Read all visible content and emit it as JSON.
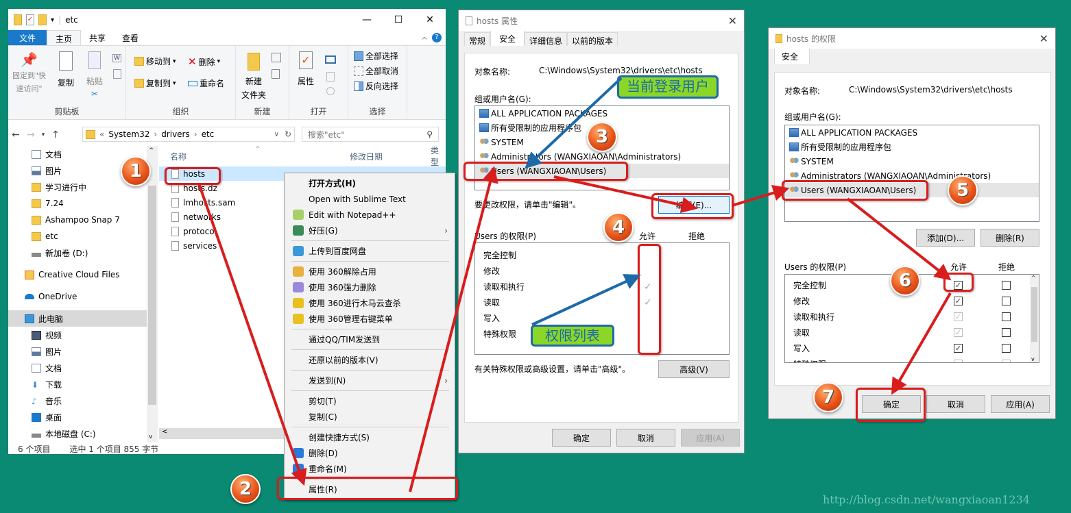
{
  "explorer": {
    "title": "etc",
    "window_buttons": [
      "—",
      "☐",
      "✕"
    ],
    "ribbon_tabs": [
      "文件",
      "主页",
      "共享",
      "查看"
    ],
    "ribbon": {
      "clipboard": {
        "label": "剪贴板",
        "pin": "固定到\"快速访问\"",
        "pin_line1": "固定到\"快",
        "pin_line2": "速访问\"",
        "copy": "复制",
        "paste": "粘贴"
      },
      "organize": {
        "label": "组织",
        "move_to": "移动到",
        "copy_to": "复制到",
        "delete": "删除",
        "rename": "重命名"
      },
      "new": {
        "label": "新建",
        "new_folder_line1": "新建",
        "new_folder_line2": "文件夹"
      },
      "open": {
        "label": "打开",
        "properties": "属性"
      },
      "select": {
        "label": "选择",
        "select_all": "全部选择",
        "select_none": "全部取消",
        "invert": "反向选择"
      }
    },
    "address": {
      "crumbs": [
        "«",
        "System32",
        "›",
        "drivers",
        "›",
        "etc"
      ]
    },
    "search": {
      "placeholder": "搜索\"etc\""
    },
    "nav": [
      {
        "label": "文档",
        "icon": "document-icon"
      },
      {
        "label": "图片",
        "icon": "pictures-icon"
      },
      {
        "label": "学习进行中",
        "icon": "folder-icon"
      },
      {
        "label": "7.24",
        "icon": "folder-icon"
      },
      {
        "label": "Ashampoo Snap 7",
        "icon": "folder-icon"
      },
      {
        "label": "etc",
        "icon": "folder-icon"
      },
      {
        "label": "新加卷 (D:)",
        "icon": "drive-icon"
      },
      {
        "label": "Creative Cloud Files",
        "icon": "creative-cloud-icon"
      },
      {
        "label": "OneDrive",
        "icon": "onedrive-icon"
      },
      {
        "label": "此电脑",
        "icon": "computer-icon"
      },
      {
        "label": "视频",
        "icon": "video-icon"
      },
      {
        "label": "图片",
        "icon": "pictures-icon"
      },
      {
        "label": "文档",
        "icon": "document-icon"
      },
      {
        "label": "下载",
        "icon": "download-icon"
      },
      {
        "label": "音乐",
        "icon": "music-icon"
      },
      {
        "label": "桌面",
        "icon": "desktop-icon"
      },
      {
        "label": "本地磁盘 (C:)",
        "icon": "drive-icon"
      }
    ],
    "columns": [
      "名称",
      "修改日期",
      "类型"
    ],
    "files": [
      "hosts",
      "hosts.dz",
      "lmhosts.sam",
      "networks",
      "protocol",
      "services"
    ],
    "status": {
      "count": "6 个项目",
      "selected": "选中 1 个项目  855 字节"
    }
  },
  "context_menu": {
    "items": [
      {
        "label": "打开方式(H)",
        "bold": true
      },
      {
        "label": "Open with Sublime Text"
      },
      {
        "label": "Edit with Notepad++",
        "icon": "notepad-plus-icon"
      },
      {
        "label": "好压(G)",
        "icon": "haozip-icon",
        "submenu": true
      },
      {
        "sep": true
      },
      {
        "label": "上传到百度网盘",
        "icon": "baidu-cloud-icon"
      },
      {
        "sep": true
      },
      {
        "label": "使用 360解除占用",
        "icon": "360-unlock-icon"
      },
      {
        "label": "使用 360强力删除",
        "icon": "360-delete-icon"
      },
      {
        "label": "使用 360进行木马云查杀",
        "icon": "360-scan-icon"
      },
      {
        "label": "使用 360管理右键菜单",
        "icon": "360-manage-icon"
      },
      {
        "sep": true
      },
      {
        "label": "通过QQ/TIM发送到"
      },
      {
        "sep": true
      },
      {
        "label": "还原以前的版本(V)"
      },
      {
        "sep": true
      },
      {
        "label": "发送到(N)",
        "submenu": true
      },
      {
        "sep": true
      },
      {
        "label": "剪切(T)"
      },
      {
        "label": "复制(C)"
      },
      {
        "sep": true
      },
      {
        "label": "创建快捷方式(S)"
      },
      {
        "label": "删除(D)",
        "icon": "shield-icon"
      },
      {
        "label": "重命名(M)",
        "icon": "shield-icon"
      },
      {
        "sep": true
      },
      {
        "label": "属性(R)"
      }
    ]
  },
  "properties": {
    "title": "hosts 属性",
    "tabs": [
      "常规",
      "安全",
      "详细信息",
      "以前的版本"
    ],
    "active_tab": "安全",
    "object_label": "对象名称:",
    "object_path": "C:\\Windows\\System32\\drivers\\etc\\hosts",
    "group_label": "组或用户名(G):",
    "users": [
      {
        "name": "ALL APPLICATION PACKAGES",
        "icon": "package-icon"
      },
      {
        "name": "所有受限制的应用程序包",
        "icon": "package-icon"
      },
      {
        "name": "SYSTEM",
        "icon": "group-icon"
      },
      {
        "name": "Administrators (WANGXIAOAN\\Administrators)",
        "icon": "group-icon"
      },
      {
        "name": "Users (WANGXIAOAN\\Users)",
        "icon": "group-icon",
        "selected": true
      }
    ],
    "edit_hint": "要更改权限，请单击\"编辑\"。",
    "edit_button": "编辑(E)...",
    "perm_label": "Users 的权限(P)",
    "allow": "允许",
    "deny": "拒绝",
    "permissions": [
      {
        "name": "完全控制",
        "allow": false
      },
      {
        "name": "修改",
        "allow": false
      },
      {
        "name": "读取和执行",
        "allow": true
      },
      {
        "name": "读取",
        "allow": true
      },
      {
        "name": "写入",
        "allow": false
      },
      {
        "name": "特殊权限",
        "allow": false
      }
    ],
    "advanced_hint": "有关特殊权限或高级设置，请单击\"高级\"。",
    "advanced_button": "高级(V)",
    "ok": "确定",
    "cancel": "取消",
    "apply": "应用(A)"
  },
  "permissions_dialog": {
    "title": "hosts 的权限",
    "tab": "安全",
    "object_label": "对象名称:",
    "object_path": "C:\\Windows\\System32\\drivers\\etc\\hosts",
    "group_label": "组或用户名(G):",
    "users": [
      {
        "name": "ALL APPLICATION PACKAGES",
        "icon": "package-icon"
      },
      {
        "name": "所有受限制的应用程序包",
        "icon": "package-icon"
      },
      {
        "name": "SYSTEM",
        "icon": "group-icon"
      },
      {
        "name": "Administrators (WANGXIAOAN\\Administrators)",
        "icon": "group-icon"
      },
      {
        "name": "Users (WANGXIAOAN\\Users)",
        "icon": "group-icon",
        "selected": true
      }
    ],
    "add_button": "添加(D)...",
    "remove_button": "删除(R)",
    "perm_label": "Users 的权限(P)",
    "allow": "允许",
    "deny": "拒绝",
    "permissions": [
      {
        "name": "完全控制",
        "allow": "checked",
        "deny": "unchecked"
      },
      {
        "name": "修改",
        "allow": "checked",
        "deny": "unchecked"
      },
      {
        "name": "读取和执行",
        "allow": "checked-disabled",
        "deny": "unchecked"
      },
      {
        "name": "读取",
        "allow": "checked-disabled",
        "deny": "unchecked"
      },
      {
        "name": "写入",
        "allow": "checked",
        "deny": "unchecked"
      },
      {
        "name": "特殊权限",
        "allow": "disabled",
        "deny": "disabled"
      }
    ],
    "ok": "确定",
    "cancel": "取消",
    "apply": "应用(A)"
  },
  "annotations": {
    "steps": [
      "1",
      "2",
      "3",
      "4",
      "5",
      "6",
      "7"
    ],
    "callout_user": "当前登录用户",
    "callout_perms": "权限列表",
    "highlight_color": "#d91c1c",
    "callout_color": "#8bd728",
    "arrow_blue": "#1e6aa8"
  },
  "watermark": "http://blog.csdn.net/wangxiaoan1234"
}
